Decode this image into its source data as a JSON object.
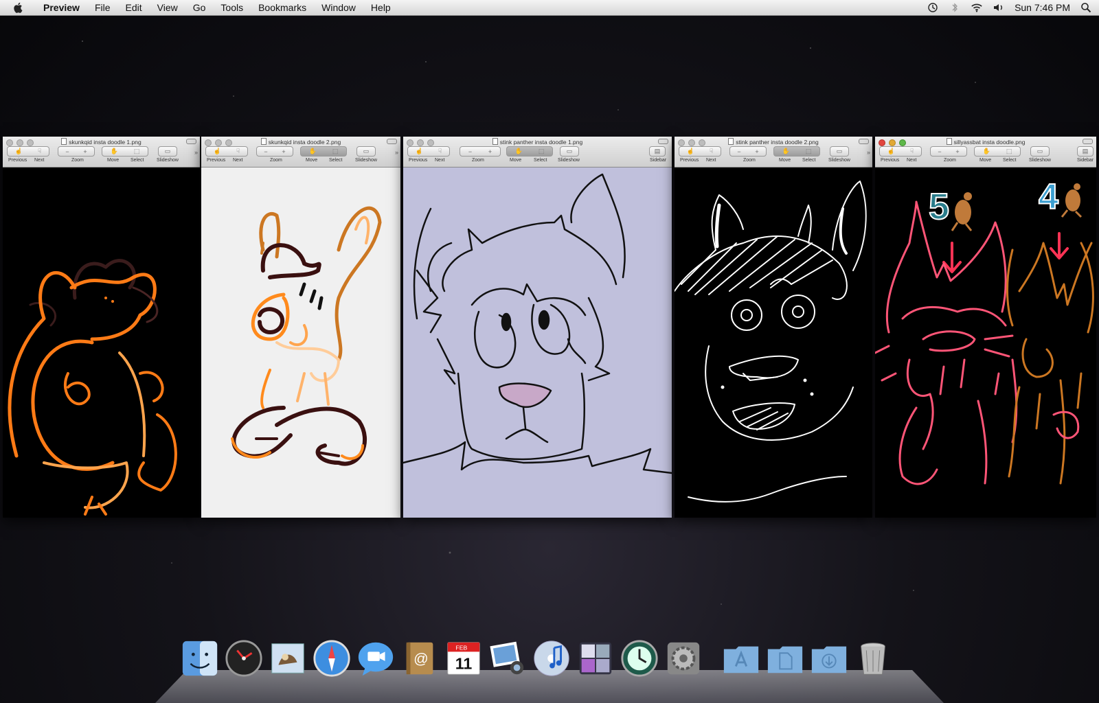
{
  "menubar": {
    "app_name": "Preview",
    "items": [
      "File",
      "Edit",
      "View",
      "Go",
      "Tools",
      "Bookmarks",
      "Window",
      "Help"
    ],
    "clock": "Sun 7:46 PM"
  },
  "toolbar_labels": {
    "previous": "Previous",
    "next": "Next",
    "zoom": "Zoom",
    "move": "Move",
    "select": "Select",
    "slideshow": "Slideshow",
    "sidebar": "Sidebar"
  },
  "windows": [
    {
      "title": "skunkqid insta doodle 1.png",
      "active": false,
      "bg": "#000000"
    },
    {
      "title": "skunkqid insta doodle 2.png",
      "active": false,
      "bg": "#f0f0f0"
    },
    {
      "title": "stink panther insta doodle 1.png",
      "active": false,
      "bg": "#c0c0dc"
    },
    {
      "title": "stink panther insta doodle 2.png",
      "active": false,
      "bg": "#000000"
    },
    {
      "title": "sillyassbat insta doodle.png",
      "active": true,
      "bg": "#000000"
    }
  ],
  "doodle_numbers": {
    "left": "5",
    "right": "4"
  },
  "calendar": {
    "month": "FEB",
    "day": "11"
  },
  "dock": [
    "finder",
    "dashboard",
    "mail",
    "safari",
    "ichat",
    "address-book",
    "ical",
    "iphoto",
    "itunes",
    "spaces",
    "time-machine",
    "system-preferences",
    "applications-folder",
    "documents-folder",
    "downloads-folder",
    "trash"
  ],
  "colors": {
    "active_close": "#e2463f",
    "active_min": "#e1a935",
    "active_zoom": "#5fb84a"
  }
}
